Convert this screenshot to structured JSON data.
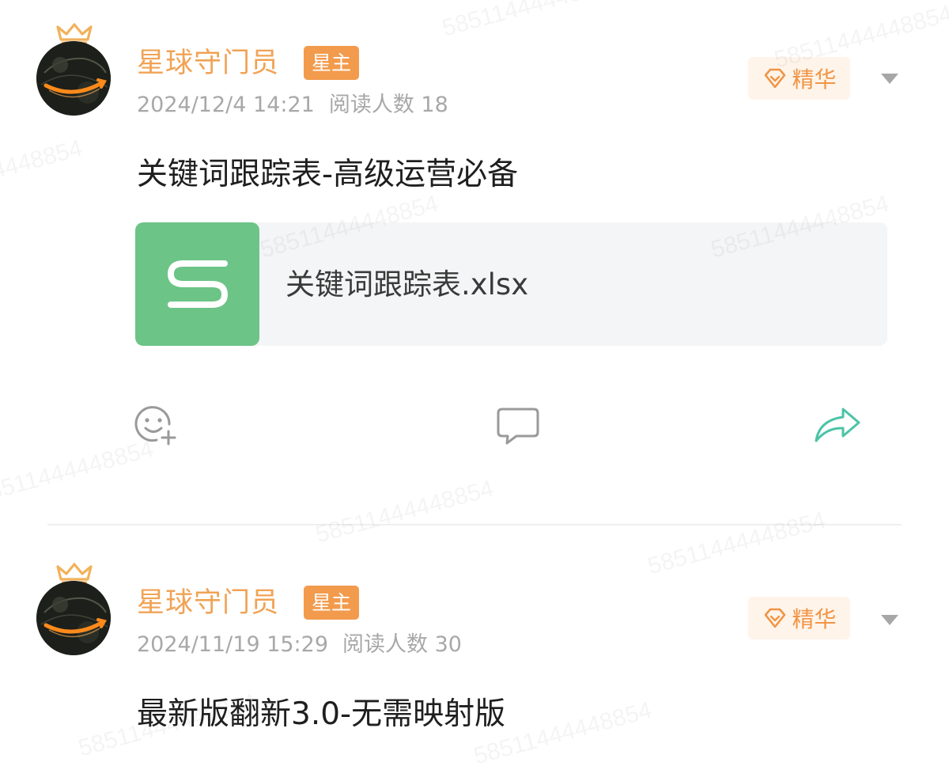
{
  "watermark": {
    "text": "58511444448854"
  },
  "posts": [
    {
      "author": "星球守门员",
      "role_badge": "星主",
      "date": "2024/12/4 14:21",
      "read_label": "阅读人数 18",
      "featured_label": "精华",
      "title": "关键词跟踪表-高级运营必备",
      "attachment": {
        "file_name": "关键词跟踪表.xlsx",
        "icon": "spreadsheet-s-icon"
      },
      "actions": {
        "like_icon": "emoji-add-icon",
        "comment_icon": "comment-bubble-icon",
        "share_icon": "share-arrow-icon"
      }
    },
    {
      "author": "星球守门员",
      "role_badge": "星主",
      "date": "2024/11/19 15:29",
      "read_label": "阅读人数 30",
      "featured_label": "精华",
      "title": "最新版翻新3.0-无需映射版"
    }
  ],
  "colors": {
    "author": "#f0a355",
    "role_badge_bg": "#f29b4d",
    "featured_bg": "#fff4ea",
    "featured_text": "#f09545",
    "file_icon_bg": "#6cc487",
    "share_icon": "#4cc3a7",
    "meta_text": "#a8a8a8"
  }
}
